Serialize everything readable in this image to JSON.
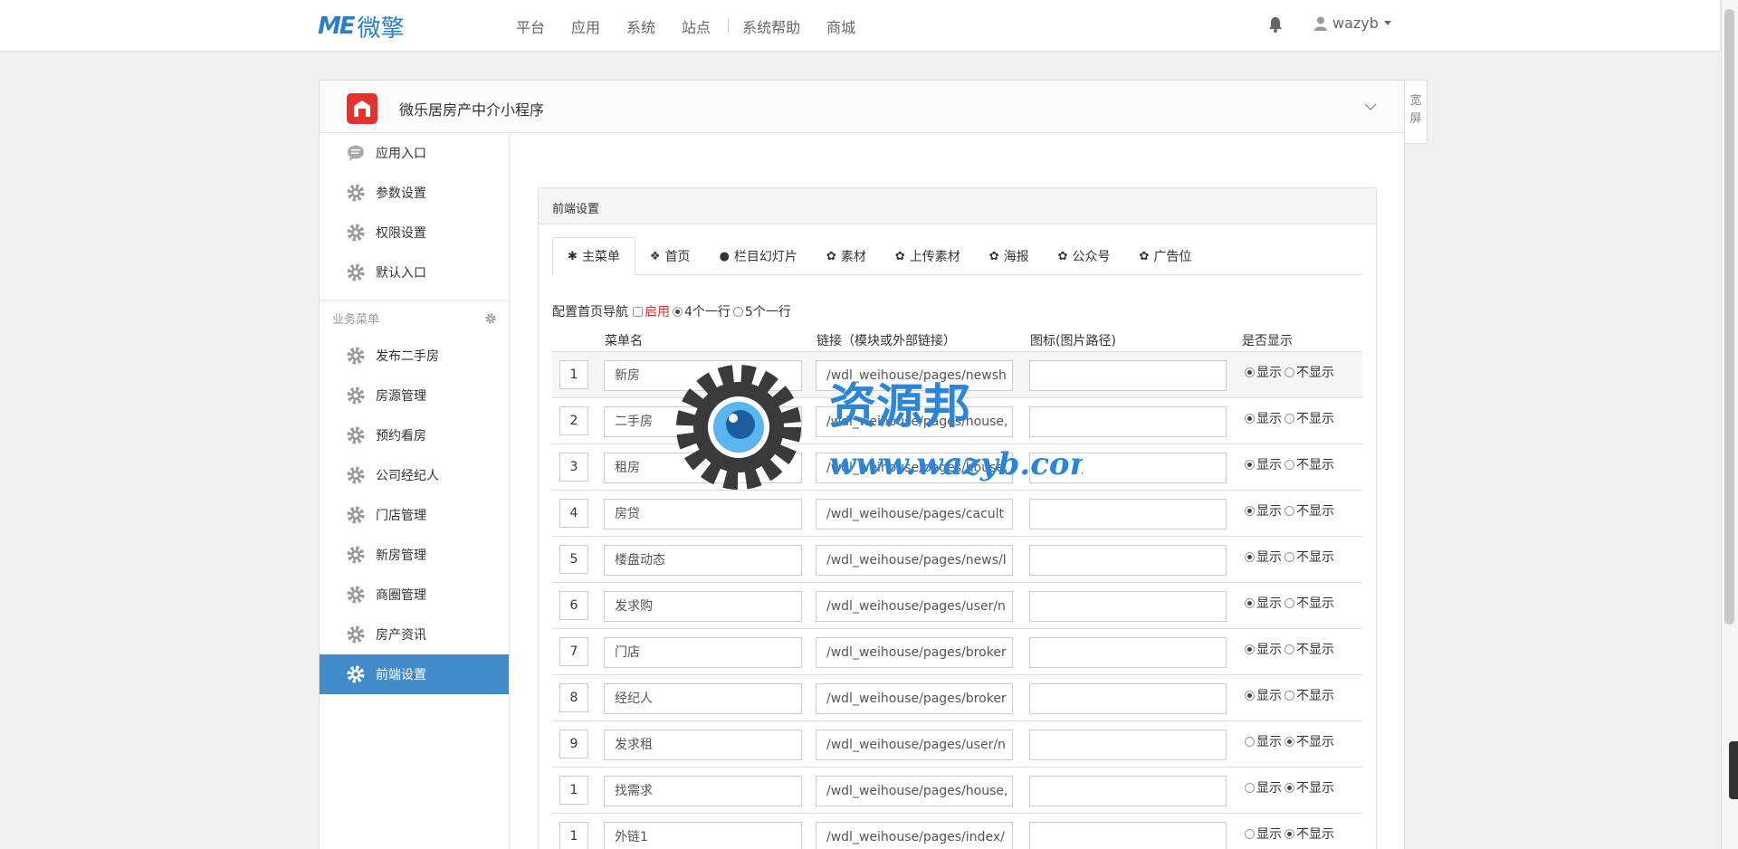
{
  "topnav": {
    "logo_me": "ME",
    "logo_cn": "微擎",
    "items": [
      "平台",
      "应用",
      "系统",
      "站点",
      "系统帮助",
      "商城"
    ],
    "username": "wazyb"
  },
  "app": {
    "title": "微乐居房产中介小程序",
    "wide_label": "宽屏"
  },
  "sidebar": {
    "top_items": [
      "应用入口",
      "参数设置",
      "权限设置",
      "默认入口"
    ],
    "group_label": "业务菜单",
    "items": [
      "发布二手房",
      "房源管理",
      "预约看房",
      "公司经纪人",
      "门店管理",
      "新房管理",
      "商圈管理",
      "房产资讯",
      "前端设置"
    ]
  },
  "panel": {
    "title": "前端设置",
    "tabs": [
      "主菜单",
      "首页",
      "栏目幻灯片",
      "素材",
      "上传素材",
      "海报",
      "公众号",
      "广告位"
    ],
    "options": {
      "label": "配置首页导航",
      "enable": "启用",
      "four": "4个一行",
      "five": "5个一行"
    },
    "headers": {
      "name": "菜单名",
      "link": "链接（模块或外部链接）",
      "icon": "图标(图片路径)",
      "show": "是否显示"
    },
    "show_label": "显示",
    "hide_label": "不显示",
    "rows": [
      {
        "idx": "1",
        "name": "新房",
        "link": "/wdl_weihouse/pages/newsh",
        "shown": true
      },
      {
        "idx": "2",
        "name": "二手房",
        "link": "/wdl_weihouse/pages/house,",
        "shown": true
      },
      {
        "idx": "3",
        "name": "租房",
        "link": "/wdl_weihouse/pages/house,",
        "shown": true
      },
      {
        "idx": "4",
        "name": "房贷",
        "link": "/wdl_weihouse/pages/cacult",
        "shown": true
      },
      {
        "idx": "5",
        "name": "楼盘动态",
        "link": "/wdl_weihouse/pages/news/l",
        "shown": true
      },
      {
        "idx": "6",
        "name": "发求购",
        "link": "/wdl_weihouse/pages/user/n",
        "shown": true
      },
      {
        "idx": "7",
        "name": "门店",
        "link": "/wdl_weihouse/pages/broker",
        "shown": true
      },
      {
        "idx": "8",
        "name": "经纪人",
        "link": "/wdl_weihouse/pages/broker",
        "shown": true
      },
      {
        "idx": "9",
        "name": "发求租",
        "link": "/wdl_weihouse/pages/user/n",
        "shown": false
      },
      {
        "idx": "1",
        "name": "找需求",
        "link": "/wdl_weihouse/pages/house,",
        "shown": false
      },
      {
        "idx": "1",
        "name": "外链1",
        "link": "/wdl_weihouse/pages/index/",
        "shown": false
      }
    ]
  },
  "watermark": {
    "line1": "资源邦",
    "line2": "www.wazyb.com"
  },
  "colors": {
    "accent": "#428bca",
    "brand": "#2a7fc9",
    "red": "#e5322d"
  }
}
